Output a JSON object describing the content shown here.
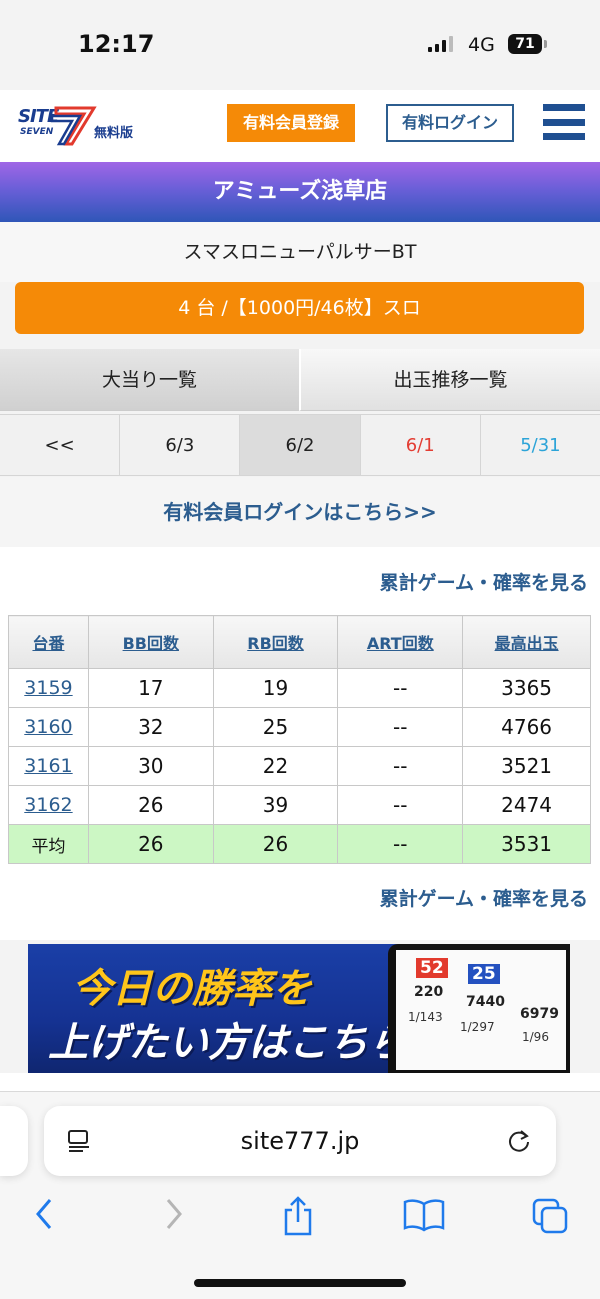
{
  "status_bar": {
    "time": "12:17",
    "network": "4G",
    "battery": "71"
  },
  "header": {
    "logo_site": "SITE",
    "logo_seven": "SEVEN",
    "logo_free": "無料版",
    "register_label": "有料会員登録",
    "login_label": "有料ログイン"
  },
  "store": {
    "name": "アミューズ浅草店",
    "machine": "スマスロニューパルサーBT",
    "rate_info": "4 台 /【1000円/46枚】スロ"
  },
  "tabs": [
    {
      "label": "大当り一覧"
    },
    {
      "label": "出玉推移一覧"
    }
  ],
  "dates": [
    {
      "label": "<<"
    },
    {
      "label": "6/3"
    },
    {
      "label": "6/2"
    },
    {
      "label": "6/1"
    },
    {
      "label": "5/31"
    }
  ],
  "member_login": "有料会員ログインはこちら>>",
  "see_more": "累計ゲーム・確率を見る",
  "table": {
    "headers": [
      "台番",
      "BB回数",
      "RB回数",
      "ART回数",
      "最高出玉"
    ],
    "rows": [
      {
        "id": "3159",
        "bb": "17",
        "rb": "19",
        "art": "--",
        "max": "3365"
      },
      {
        "id": "3160",
        "bb": "32",
        "rb": "25",
        "art": "--",
        "max": "4766"
      },
      {
        "id": "3161",
        "bb": "30",
        "rb": "22",
        "art": "--",
        "max": "3521"
      },
      {
        "id": "3162",
        "bb": "26",
        "rb": "39",
        "art": "--",
        "max": "2474"
      }
    ],
    "average": {
      "label": "平均",
      "bb": "26",
      "rb": "26",
      "art": "--",
      "max": "3531"
    }
  },
  "banner": {
    "line1": "今日の勝率を",
    "line2": "上げたい方はこちら",
    "screen_values": [
      "52",
      "25",
      "220",
      "7440",
      "6979",
      "1/143",
      "1/297",
      "1/96"
    ]
  },
  "browser": {
    "url": "site777.jp"
  },
  "colors": {
    "accent_orange": "#f58a07",
    "link_blue": "#2c5d8f",
    "avg_green": "#ccf7c4",
    "saturday_red": "#e33d33",
    "sunday_blue": "#2ca4d8"
  }
}
